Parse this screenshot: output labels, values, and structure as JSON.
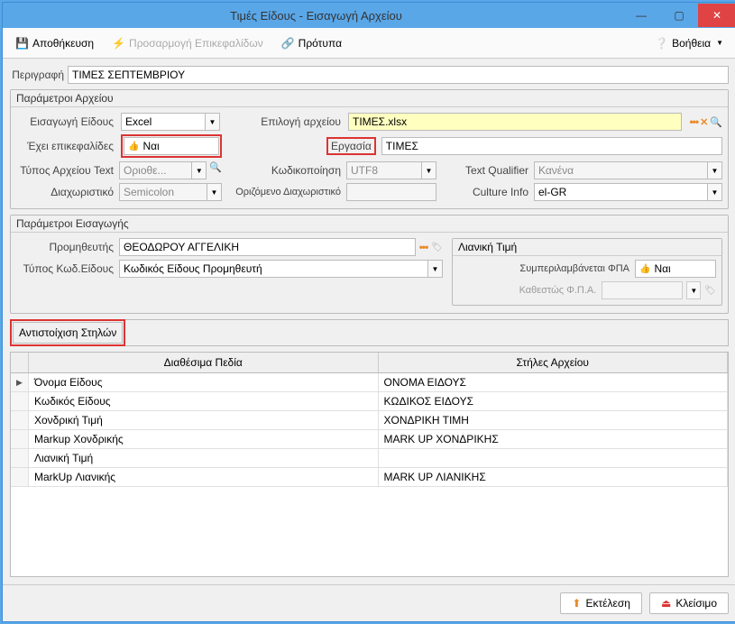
{
  "titlebar": {
    "title": "Τιμές Είδους - Εισαγωγή Αρχείου"
  },
  "toolbar": {
    "save": "Αποθήκευση",
    "headers_adjust": "Προσαρμογή Επικεφαλίδων",
    "templates": "Πρότυπα",
    "help": "Βοήθεια"
  },
  "description": {
    "label": "Περιγραφή",
    "value": "ΤΙΜΕΣ ΣΕΠΤΕΜΒΡΙΟΥ"
  },
  "file_params": {
    "title": "Παράμετροι Αρχείου",
    "import_type_label": "Εισαγωγή Είδους",
    "import_type": "Excel",
    "file_select_label": "Επιλογή αρχείου",
    "file_select": "ΤΙΜΕΣ.xlsx",
    "has_headers_label": "Έχει επικεφαλίδες",
    "has_headers": "Ναι",
    "work_label": "Εργασία",
    "work": "ΤΙΜΕΣ",
    "text_type_label": "Τύπος Αρχείου Text",
    "text_type": "Οριοθε...",
    "encoding_label": "Κωδικοποίηση",
    "encoding": "UTF8",
    "text_qualifier_label": "Text Qualifier",
    "text_qualifier": "Κανένα",
    "delimiter_label": "Διαχωριστικό",
    "delimiter": "Semicolon",
    "custom_delimiter_label": "Οριζόμενο Διαχωριστικό",
    "custom_delimiter": "",
    "culture_label": "Culture Info",
    "culture": "el-GR"
  },
  "import_params": {
    "title": "Παράμετροι Εισαγωγής",
    "supplier_label": "Προμηθευτής",
    "supplier": "ΘΕΟΔΩΡΟΥ ΑΓΓΕΛΙΚΗ",
    "code_type_label": "Τύπος Κωδ.Είδους",
    "code_type": "Κωδικός Είδους Προμηθευτή",
    "retail_title": "Λιανική Τιμή",
    "vat_included_label": "Συμπεριλαμβάνεται ΦΠΑ",
    "vat_included": "Ναι",
    "vat_status_label": "Καθεστώς Φ.Π.Α."
  },
  "mapping": {
    "title": "Αντιστοίχιση Στηλών",
    "col_available": "Διαθέσιμα Πεδία",
    "col_file": "Στήλες Αρχείου",
    "rows": [
      {
        "field": "Όνομα Είδους",
        "file": "ΟΝΟΜΑ ΕΙΔΟΥΣ"
      },
      {
        "field": "Κωδικός Είδους",
        "file": "ΚΩΔΙΚΟΣ ΕΙΔΟΥΣ"
      },
      {
        "field": "Χονδρική Τιμή",
        "file": "ΧΟΝΔΡΙΚΗ ΤΙΜΗ"
      },
      {
        "field": "Markup Χονδρικής",
        "file": "MARK UP ΧΟΝΔΡΙΚΗΣ"
      },
      {
        "field": "Λιανική Τιμή",
        "file": ""
      },
      {
        "field": "MarkUp Λιανικής",
        "file": "MARK UP ΛΙΑΝΙΚΗΣ"
      }
    ]
  },
  "footer": {
    "execute": "Εκτέλεση",
    "close": "Κλείσιμο"
  }
}
